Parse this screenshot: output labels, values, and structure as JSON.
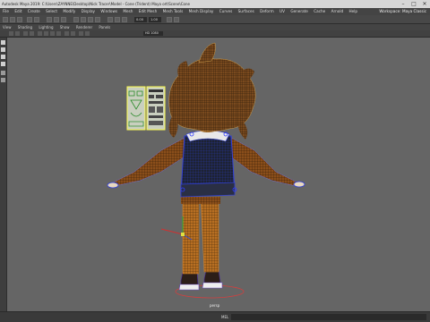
{
  "titlebar": {
    "title": "Autodesk Maya 2019: C:\\Users\\ZAYNNE\\Desktop\\Nick Tracer\\Model - Cone (Trident) Maya ort\\Scene\\Cone",
    "min": "–",
    "max": "□",
    "close": "✕"
  },
  "menubar": {
    "items": [
      "File",
      "Edit",
      "Create",
      "Select",
      "Modify",
      "Display",
      "Windows",
      "Mesh",
      "Edit Mesh",
      "Mesh Tools",
      "Mesh Display",
      "Curves",
      "Surfaces",
      "Deform",
      "UV",
      "Generate",
      "Cache",
      "Arnold",
      "Help"
    ],
    "workspace": "Workspace: Maya Classic"
  },
  "toolbar": {
    "field_value": "0.00",
    "field_value2": "1.00"
  },
  "panel_menu": {
    "items": [
      "View",
      "Shading",
      "Lighting",
      "Show",
      "Renderer",
      "Panels"
    ]
  },
  "viewtools": {
    "resolution": "HD 1080"
  },
  "viewport": {
    "camera_label": "persp"
  },
  "command_line": {
    "label": "MEL"
  },
  "colors": {
    "viewport_bg": "#656565",
    "wire_orange": "#c47a24",
    "select_blue": "#2f3cff",
    "jacket": "#1f2536"
  }
}
